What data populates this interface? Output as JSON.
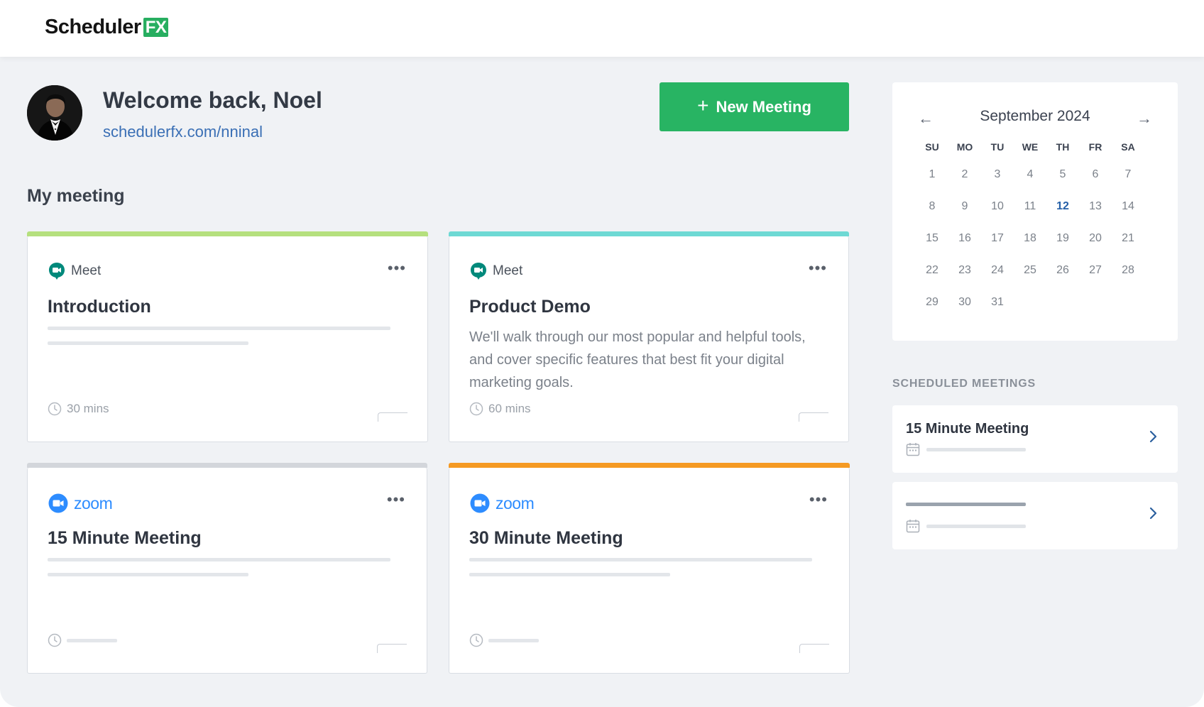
{
  "header": {
    "logo_text": "Scheduler",
    "logo_badge": "FX"
  },
  "profile": {
    "greeting": "Welcome back, Noel",
    "link": "schedulerfx.com/nninal"
  },
  "actions": {
    "new_meeting_label": "New Meeting",
    "new_meeting_icon": "plus-icon"
  },
  "meetings": {
    "section_title": "My meeting",
    "cards": [
      {
        "provider": "Meet",
        "provider_icon": "google-meet-icon",
        "title": "Introduction",
        "description": "",
        "duration": "30 mins",
        "accent": "#b5e07e"
      },
      {
        "provider": "Meet",
        "provider_icon": "google-meet-icon",
        "title": "Product Demo",
        "description": "We'll walk through our most popular and helpful tools, and cover specific features that best fit your digital marketing goals.",
        "duration": "60 mins",
        "accent": "#6ed9d4"
      },
      {
        "provider": "zoom",
        "provider_icon": "zoom-icon",
        "title": "15 Minute Meeting",
        "description": "",
        "duration": "",
        "accent": "#d3d6db"
      },
      {
        "provider": "zoom",
        "provider_icon": "zoom-icon",
        "title": "30 Minute Meeting",
        "description": "",
        "duration": "",
        "accent": "#f59a23"
      }
    ]
  },
  "calendar": {
    "month": "September 2024",
    "weekdays": [
      "SU",
      "MO",
      "TU",
      "WE",
      "TH",
      "FR",
      "SA"
    ],
    "days": [
      "1",
      "2",
      "3",
      "4",
      "5",
      "6",
      "7",
      "8",
      "9",
      "10",
      "11",
      "12",
      "13",
      "14",
      "15",
      "16",
      "17",
      "18",
      "19",
      "20",
      "21",
      "22",
      "23",
      "24",
      "25",
      "26",
      "27",
      "28",
      "29",
      "30",
      "31"
    ],
    "today": "12",
    "prev_icon": "arrow-left-icon",
    "next_icon": "arrow-right-icon"
  },
  "scheduled": {
    "section_title": "SCHEDULED MEETINGS",
    "items": [
      {
        "title": "15 Minute Meeting"
      },
      {
        "title": ""
      }
    ]
  },
  "colors": {
    "primary_green": "#28b463",
    "link_blue": "#3a6fb5",
    "today_blue": "#2660a8",
    "background": "#f0f2f5"
  }
}
